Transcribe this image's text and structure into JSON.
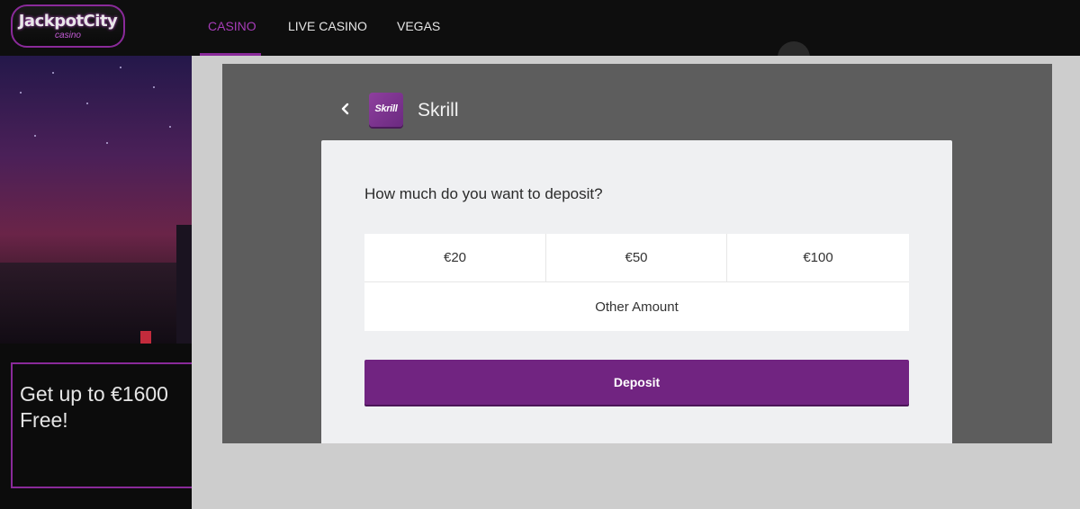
{
  "brand": {
    "logo_main": "JackpotCity",
    "logo_sub": "casino"
  },
  "nav": {
    "items": [
      {
        "label": "CASINO",
        "active": true
      },
      {
        "label": "LIVE CASINO",
        "active": false
      },
      {
        "label": "VEGAS",
        "active": false
      }
    ]
  },
  "promo": {
    "text": "Get up to €1600 Free!"
  },
  "deposit_modal": {
    "method_name": "Skrill",
    "method_logo_text": "Skrill",
    "back_icon": "chevron-left-icon",
    "question": "How much do you want to deposit?",
    "amounts": [
      "€20",
      "€50",
      "€100"
    ],
    "other_amount_label": "Other Amount",
    "deposit_button_label": "Deposit"
  },
  "colors": {
    "accent": "#712481",
    "nav_active": "#a63cb8",
    "overlay": "#cdcdcd",
    "panel": "#5d5d5d",
    "card": "#eff0f2"
  }
}
